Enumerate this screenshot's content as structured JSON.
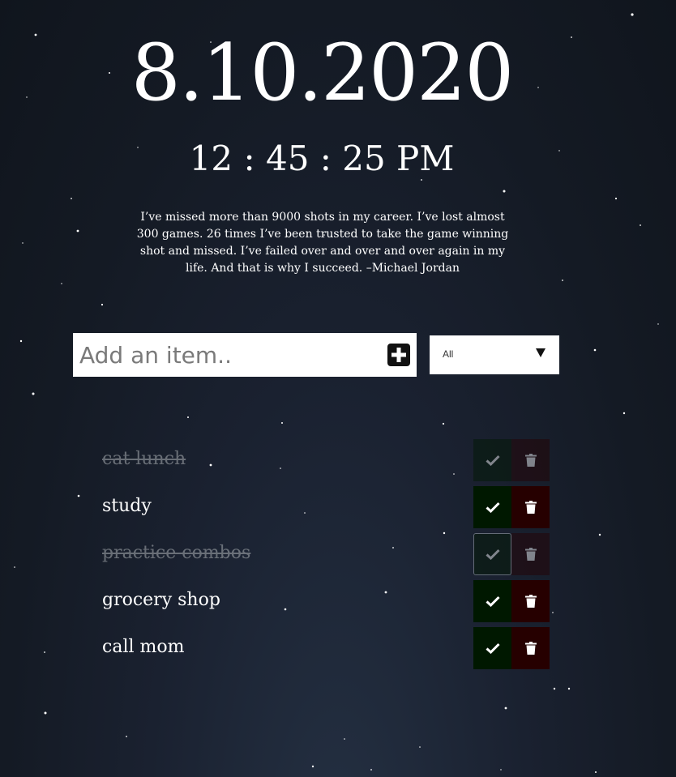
{
  "clock_widget": {
    "date": "8.10.2020",
    "time": "12 : 45 : 25 PM"
  },
  "quote": {
    "text": "I’ve missed more than 9000 shots in my career. I’ve lost almost 300 games. 26 times I’ve been trusted to take the game winning shot and missed. I’ve failed over and over and over again in my life. And that is why I succeed. –Michael Jordan"
  },
  "add_form": {
    "placeholder": "Add an item..",
    "value": "",
    "add_icon": "plus-square-icon"
  },
  "filter": {
    "selected": "All",
    "arrow_icon": "triangle-down-icon"
  },
  "todos": [
    {
      "text": "cat lunch",
      "completed": true
    },
    {
      "text": "study",
      "completed": false
    },
    {
      "text": "practice combos",
      "completed": true
    },
    {
      "text": "grocery shop",
      "completed": false
    },
    {
      "text": "call mom",
      "completed": false
    }
  ],
  "icons": {
    "complete": "check-icon",
    "delete": "trash-icon"
  },
  "colors": {
    "background": "#161c26",
    "check_button": "#001800",
    "trash_button": "#260000",
    "completed_text": "#9ea3a8",
    "panel": "#ffffff"
  }
}
